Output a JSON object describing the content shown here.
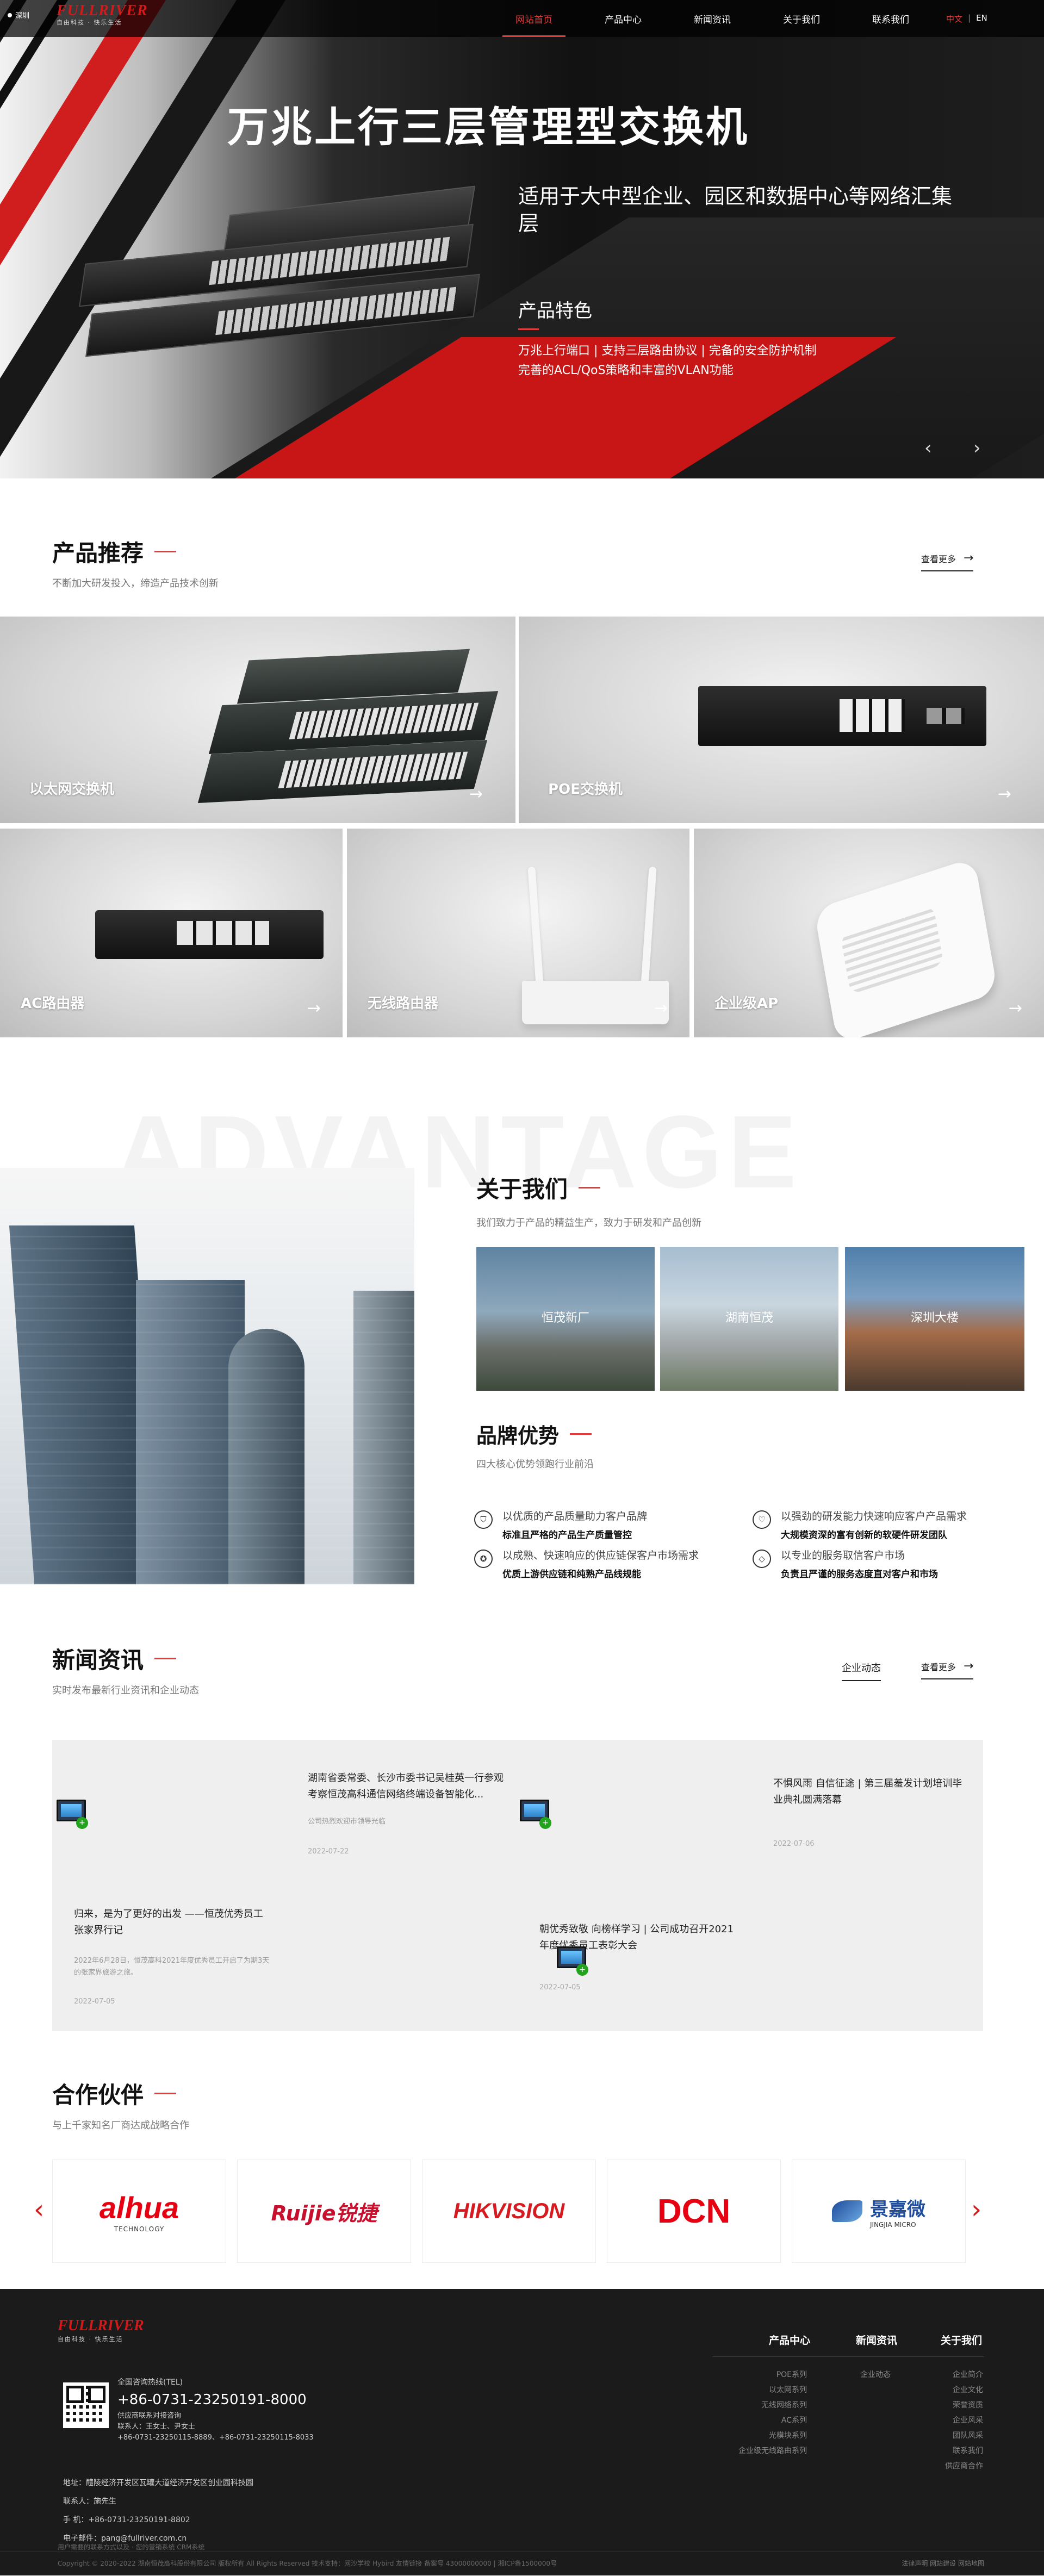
{
  "header": {
    "weather": "深圳",
    "logo_brand": "FULLRIVER",
    "logo_slogan": "自由科技 · 快乐生活",
    "nav": [
      {
        "label": "网站首页",
        "active": true
      },
      {
        "label": "产品中心",
        "active": false
      },
      {
        "label": "新闻资讯",
        "active": false
      },
      {
        "label": "关于我们",
        "active": false
      },
      {
        "label": "联系我们",
        "active": false
      }
    ],
    "lang_cn": "中文",
    "lang_sep": "|",
    "lang_en": "EN"
  },
  "hero": {
    "title": "万兆上行三层管理型交换机",
    "subtitle": "适用于大中型企业、园区和数据中心等网络汇集层",
    "feature_title": "产品特色",
    "feature_line1": "万兆上行端口 | 支持三层路由协议 | 完备的安全防护机制",
    "feature_line2": "完善的ACL/QoS策略和丰富的VLAN功能",
    "prev_icon": "‹",
    "next_icon": "›"
  },
  "products": {
    "title": "产品推荐",
    "subtitle": "不断加大研发投入，缔造产品技术创新",
    "more": "查看更多",
    "items": [
      {
        "name": "以太网交换机"
      },
      {
        "name": "POE交换机"
      },
      {
        "name": "AC路由器"
      },
      {
        "name": "无线路由器"
      },
      {
        "name": "企业级AP"
      }
    ]
  },
  "about": {
    "bg_word": "ADVANTAGE",
    "title": "关于我们",
    "subtitle": "我们致力于产品的精益生产，致力于研发和产品创新",
    "images": [
      {
        "label": "恒茂新厂"
      },
      {
        "label": "湖南恒茂"
      },
      {
        "label": "深圳大楼"
      }
    ]
  },
  "brand": {
    "title": "品牌优势",
    "subtitle": "四大核心优势领跑行业前沿",
    "items": [
      {
        "line1": "以优质的产品质量助力客户品牌",
        "line2": "标准且严格的产品生产质量管控",
        "icon": "shield-icon"
      },
      {
        "line1": "以强劲的研发能力快速响应客户产品需求",
        "line2": "大规模资深的富有创新的软硬件研发团队",
        "icon": "heart-icon"
      },
      {
        "line1": "以成熟、快速响应的供应链保客户市场需求",
        "line2": "优质上游供应链和纯熟产品线规能",
        "icon": "medal-icon"
      },
      {
        "line1": "以专业的服务取信客户市场",
        "line2": "负责且严谨的服务态度直对客户和市场",
        "icon": "diamond-icon"
      }
    ]
  },
  "news": {
    "title": "新闻资讯",
    "subtitle": "实时发布最新行业资讯和企业动态",
    "tab": "企业动态",
    "more": "查看更多",
    "items": [
      {
        "title": "湖南省委常委、长沙市委书记吴桂英一行参观考察恒茂高科通信网络终端设备智能化...",
        "summary": "公司热烈欢迎市领导光临",
        "date": "2022-07-22"
      },
      {
        "title": "不惧风雨 自信征途 | 第三届羞发计划培训毕业典礼圆满落幕",
        "summary": "",
        "date": "2022-07-06"
      },
      {
        "title": "归来，是为了更好的出发 ——恒茂优秀员工张家界行记",
        "summary": "2022年6月28日，恒茂高科2021年度优秀员工开启了为期3天的张家界旅游之旅。",
        "date": "2022-07-05"
      },
      {
        "title": "朝优秀致敬 向榜样学习 | 公司成功召开2021年度优秀员工表彰大会",
        "summary": "",
        "date": "2022-07-05"
      }
    ]
  },
  "partners": {
    "title": "合作伙伴",
    "subtitle": "与上千家知名厂商达成战略合作",
    "prev": "‹",
    "next": "›",
    "items": [
      {
        "name": "alhua",
        "sub": "TECHNOLOGY",
        "color": "#e60012"
      },
      {
        "name": "Ruijie锐捷",
        "sub": "",
        "color": "#c8102e"
      },
      {
        "name": "HIKVISION",
        "sub": "",
        "color": "#d71920"
      },
      {
        "name": "DCN",
        "sub": "",
        "color": "#e60012"
      },
      {
        "name": "景嘉微",
        "sub": "JINGJIA MICRO",
        "color": "#1e4b9b"
      }
    ]
  },
  "footer": {
    "brand": "FULLRIVER",
    "slogan": "自由科技 · 快乐生活",
    "hotline_label": "全国咨询热线(TEL)",
    "hotline": "+86-0731-23250191-8000",
    "supply_label": "供应商联系对接咨询",
    "supply_contact": "联系人：王女士、尹女士",
    "supply_phone": "+86-0731-23250115-8889、+86-0731-23250115-8033",
    "address": "地址：醴陵经济开发区瓦罐大道经济开发区创业园科技园",
    "contact": "联系人：施先生",
    "mobile": "手 机：+86-0731-23250191-8802",
    "email": "电子邮件：pang@fullriver.com.cn",
    "col_titles": [
      "产品中心",
      "新闻资讯",
      "关于我们"
    ],
    "col1": [
      "POE系列",
      "以太网系列",
      "无线网络系列",
      "AC系列",
      "光模块系列",
      "企业级无线路由系列"
    ],
    "col2": [
      "企业动态"
    ],
    "col3": [
      "企业简介",
      "企业文化",
      "荣誉资质",
      "企业风采",
      "团队风采",
      "联系我们",
      "供应商合作"
    ],
    "copyright": "Copyright © 2020-2022 湖南恒茂高科股份有限公司 版权所有 All Rights Reserved 技术支持：网沙学校 Hybird 友情链接 备案号 43000000000 | 湘ICP备1500000号",
    "bottom_links": "法律声明 网站建设 网站地图",
    "top_links": "用户需要的联系方式以及 · 您的营销系统 CRM系统"
  }
}
